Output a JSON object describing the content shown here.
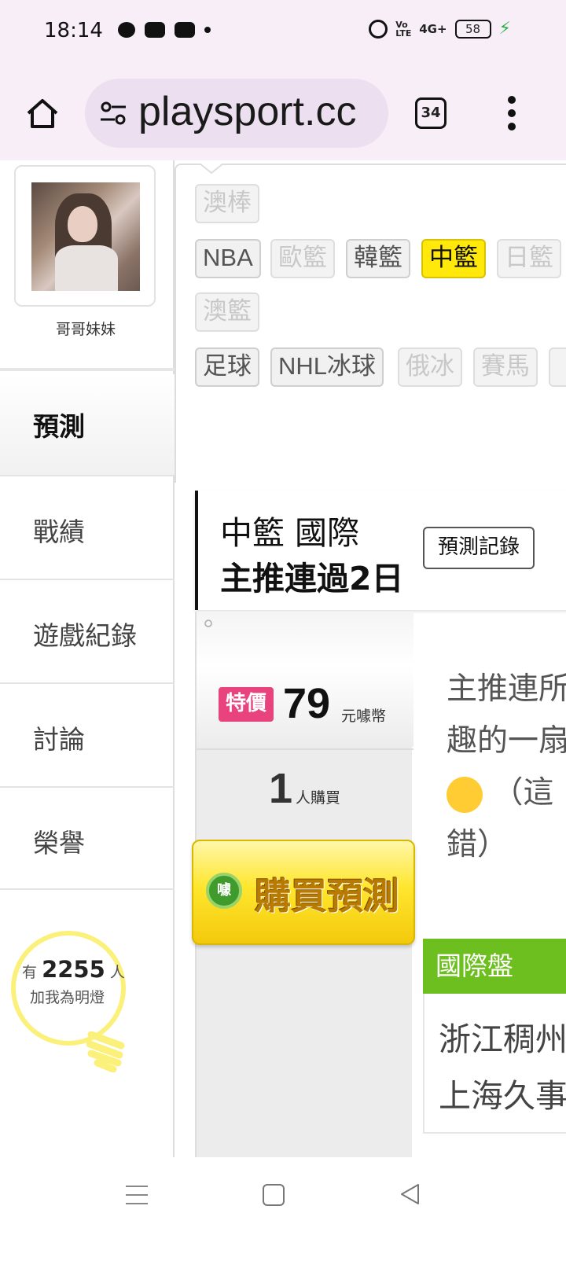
{
  "status_bar": {
    "time": "18:14",
    "volte": "Vo LTE",
    "signal": "4G+",
    "battery": "58"
  },
  "browser": {
    "url": "playsport.cc",
    "tab_count": "34"
  },
  "sidebar": {
    "username": "哥哥妹妹",
    "nav": [
      {
        "label": "預測",
        "active": true
      },
      {
        "label": "戰績"
      },
      {
        "label": "遊戲紀錄"
      },
      {
        "label": "討論"
      },
      {
        "label": "榮譽"
      }
    ],
    "fans": {
      "prefix": "有",
      "count": "2255",
      "suffix": "人",
      "label": "加我為明燈"
    }
  },
  "sport_tabs": {
    "row1": [
      "澳棒"
    ],
    "row2": [
      "NBA",
      "歐籃",
      "韓籃",
      "中籃",
      "日籃"
    ],
    "row3": [
      "澳籃"
    ],
    "row4": [
      "足球",
      "NHL冰球",
      "俄冰",
      "賽馬"
    ],
    "active": "中籃"
  },
  "card": {
    "title_line1": "中籃 國際",
    "title_line2": "主推連過2日",
    "record_button": "預測記錄",
    "promo_badge": "特價",
    "price": "79",
    "price_unit": "元噱幣",
    "buyers_count": "1",
    "buyers_label": "人購買",
    "buy_button": "購買預測",
    "buy_logo": "噱",
    "content_lines": [
      "主推連所",
      "趣的一扇",
      "（這",
      "錯）"
    ],
    "bet_type": "國際盤",
    "teams": [
      "浙江稠州",
      "上海久事"
    ]
  },
  "colors": {
    "active_tab": "#ffe80a",
    "promo": "#e8437c",
    "bet_header": "#6cbf1e",
    "buy_button": "#ffe62e"
  }
}
